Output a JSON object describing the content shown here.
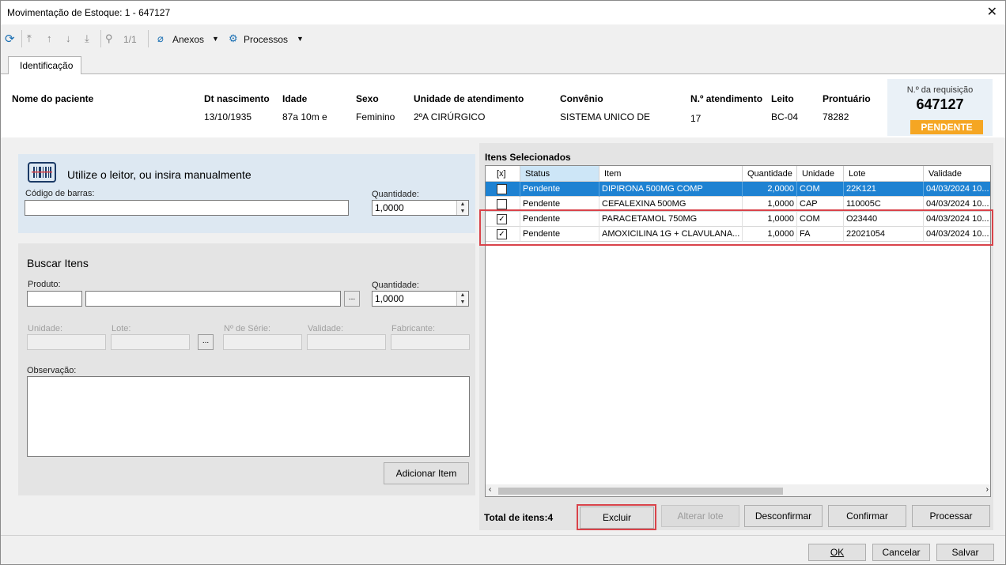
{
  "window": {
    "title": "Movimentação de Estoque: 1 - 647127",
    "close_glyph": "✕"
  },
  "toolbar": {
    "page_counter": "1/1",
    "anexos": "Anexos",
    "processos": "Processos"
  },
  "tabs": {
    "identificacao": "Identificação"
  },
  "patient": {
    "headers": [
      "Nome do paciente",
      "Dt nascimento",
      "Idade",
      "Sexo",
      "Unidade de atendimento",
      "Convênio",
      "N.º atendimento",
      "Leito",
      "Prontuário"
    ],
    "values": [
      "",
      "13/10/1935",
      "87a 10m  e",
      "Feminino",
      "2ºA CIRÚRGICO",
      "SISTEMA UNICO DE",
      "17",
      "BC-04",
      "78282"
    ]
  },
  "requisition": {
    "label": "N.º da requisição",
    "number": "647127",
    "status": "PENDENTE"
  },
  "scan": {
    "title": "Utilize o leitor, ou insira manualmente",
    "barcode_label": "Código de barras:",
    "qty_label": "Quantidade:",
    "qty_value": "1,0000"
  },
  "search": {
    "title": "Buscar Itens",
    "product_label": "Produto:",
    "qty_label": "Quantidade:",
    "qty_value": "1,0000",
    "unidade": "Unidade:",
    "lote": "Lote:",
    "serie": "Nº de Série:",
    "validade": "Validade:",
    "fabricante": "Fabricante:",
    "observacao": "Observação:",
    "add_button": "Adicionar Item",
    "ellipsis": "..."
  },
  "items": {
    "title": "Itens Selecionados",
    "columns": [
      "[x]",
      "Status",
      "Item",
      "Quantidade",
      "Unidade",
      "Lote",
      "Validade"
    ],
    "rows": [
      {
        "checked": "",
        "status": "Pendente",
        "item": "DIPIRONA 500MG COMP",
        "qty": "2,0000",
        "unit": "COM",
        "lote": "22K121",
        "validade": "04/03/2024 10..."
      },
      {
        "checked": "",
        "status": "Pendente",
        "item": "CEFALEXINA 500MG",
        "qty": "1,0000",
        "unit": "CAP",
        "lote": "110005C",
        "validade": "04/03/2024 10..."
      },
      {
        "checked": "✓",
        "status": "Pendente",
        "item": "PARACETAMOL 750MG",
        "qty": "1,0000",
        "unit": "COM",
        "lote": "O23440",
        "validade": "04/03/2024 10..."
      },
      {
        "checked": "✓",
        "status": "Pendente",
        "item": "AMOXICILINA 1G + CLAVULANA...",
        "qty": "1,0000",
        "unit": "FA",
        "lote": "22021054",
        "validade": "04/03/2024 10..."
      }
    ],
    "total_label": "Total de itens:4"
  },
  "actions": {
    "excluir": "Excluir",
    "alterar_lote": "Alterar lote",
    "desconfirmar": "Desconfirmar",
    "confirmar": "Confirmar",
    "processar": "Processar"
  },
  "footer": {
    "ok": "OK",
    "cancelar": "Cancelar",
    "salvar": "Salvar"
  }
}
